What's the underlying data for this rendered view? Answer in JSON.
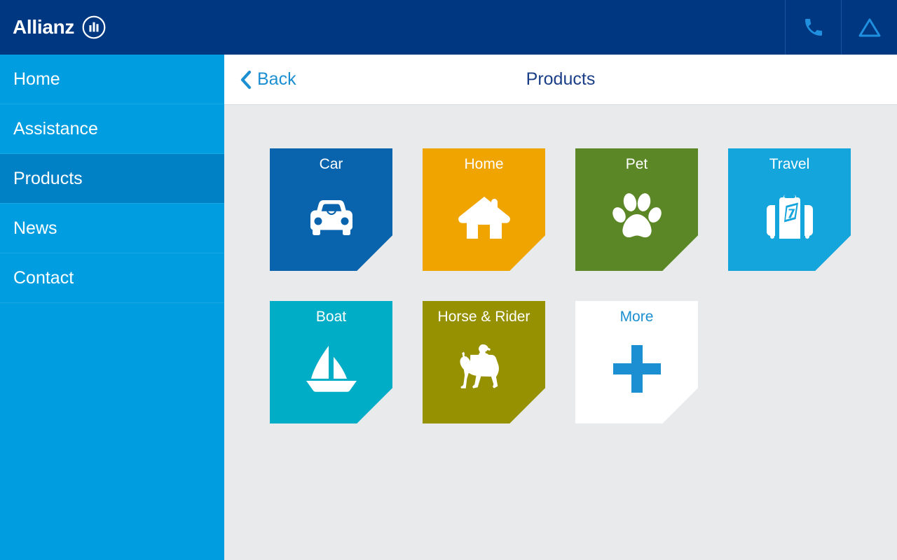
{
  "topbar": {
    "brand_name": "Allianz",
    "brand_mark": "allianz-logo-mark",
    "actions": [
      {
        "name": "phone-icon",
        "label": "Call"
      },
      {
        "name": "warning-triangle-icon",
        "label": "Alert"
      }
    ],
    "background_color": "#003781"
  },
  "sidebar": {
    "background_color": "#009ee0",
    "active_color": "#0081c6",
    "items": [
      {
        "label": "Home",
        "active": false
      },
      {
        "label": "Assistance",
        "active": false
      },
      {
        "label": "Products",
        "active": true
      },
      {
        "label": "News",
        "active": false
      },
      {
        "label": "Contact",
        "active": false
      }
    ]
  },
  "content": {
    "background_color": "#e9eaeb",
    "header": {
      "back_label": "Back",
      "back_icon": "chevron-left-icon",
      "title": "Products",
      "title_color": "#1b3f87",
      "back_color": "#1b8fd1"
    },
    "tiles": [
      {
        "label": "Car",
        "icon": "car-icon",
        "color": "#0a64ad",
        "label_color": "#ffffff",
        "icon_color": "#ffffff"
      },
      {
        "label": "Home",
        "icon": "house-icon",
        "color": "#efa400",
        "label_color": "#ffffff",
        "icon_color": "#ffffff"
      },
      {
        "label": "Pet",
        "icon": "paw-icon",
        "color": "#5c8727",
        "label_color": "#ffffff",
        "icon_color": "#ffffff"
      },
      {
        "label": "Travel",
        "icon": "suitcase-icon",
        "color": "#14a5dd",
        "label_color": "#ffffff",
        "icon_color": "#ffffff"
      },
      {
        "label": "Boat",
        "icon": "sailboat-icon",
        "color": "#00adc6",
        "label_color": "#ffffff",
        "icon_color": "#ffffff"
      },
      {
        "label": "Horse & Rider",
        "icon": "horse-rider-icon",
        "color": "#969100",
        "label_color": "#ffffff",
        "icon_color": "#ffffff"
      },
      {
        "label": "More",
        "icon": "plus-icon",
        "color": "#ffffff",
        "label_color": "#1b8fd1",
        "icon_color": "#1b8fd1"
      }
    ]
  }
}
